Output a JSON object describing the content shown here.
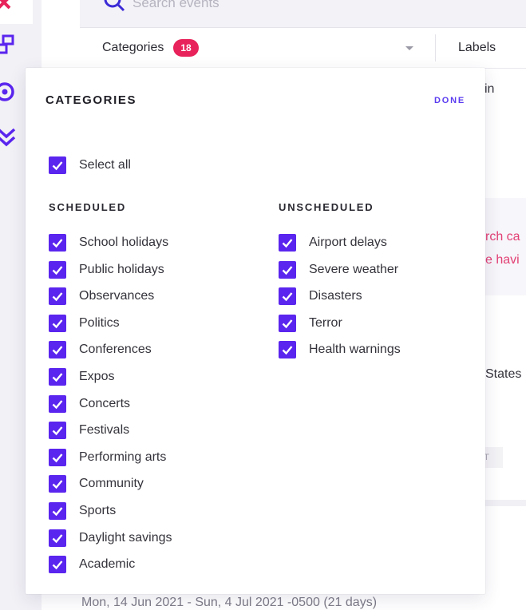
{
  "search": {
    "placeholder": "Search events"
  },
  "filterbar": {
    "categories_label": "Categories",
    "categories_count": "18",
    "labels_label": "Labels"
  },
  "background_fragments": {
    "frag_in": "in",
    "frag_rch": "rch ca",
    "frag_havi": "e havi",
    "frag_states": "States",
    "frag_tag": "T",
    "date_range": "Mon, 14 Jun 2021 - Sun, 4 Jul 2021 -0500 (21 days)"
  },
  "panel": {
    "title": "CATEGORIES",
    "done_label": "DONE",
    "select_all_label": "Select all",
    "scheduled_title": "SCHEDULED",
    "unscheduled_title": "UNSCHEDULED",
    "scheduled": [
      "School holidays",
      "Public holidays",
      "Observances",
      "Politics",
      "Conferences",
      "Expos",
      "Concerts",
      "Festivals",
      "Performing arts",
      "Community",
      "Sports",
      "Daylight savings",
      "Academic"
    ],
    "unscheduled": [
      "Airport delays",
      "Severe weather",
      "Disasters",
      "Terror",
      "Health warnings"
    ]
  },
  "colors": {
    "accent": "#5a25ee",
    "badge": "#e8225a",
    "pink_text": "#e23f74"
  },
  "icons": [
    "close-icon",
    "nodes-icon",
    "target-icon",
    "chevrons-down-icon",
    "search-icon",
    "checkmark-icon"
  ]
}
